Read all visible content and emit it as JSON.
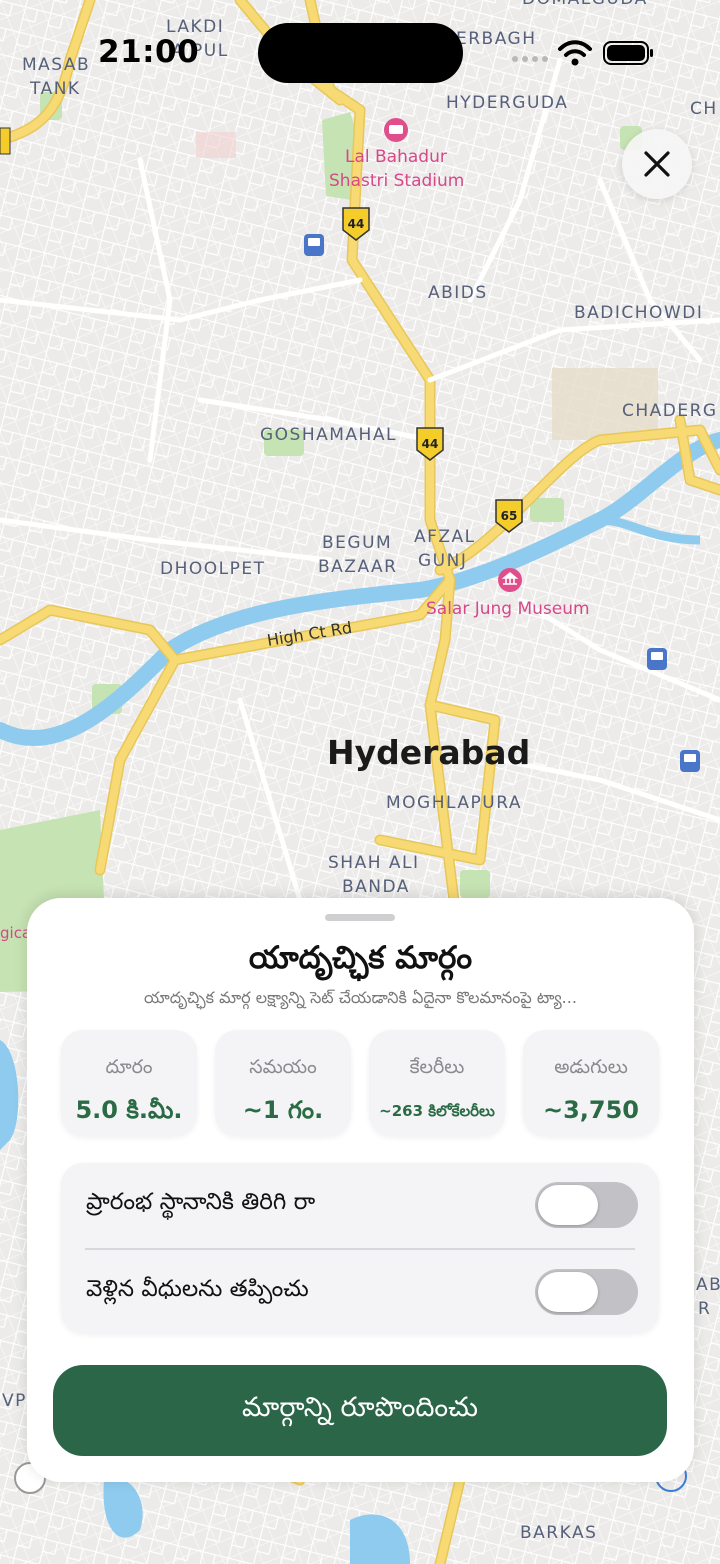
{
  "status_bar": {
    "time": "21:00"
  },
  "map": {
    "city_label": "Hyderabad",
    "labels": {
      "lakdi_ka_pul": [
        "LAKDI",
        "A PUL"
      ],
      "masab_tank": [
        "MASAB",
        "TANK"
      ],
      "himayatnagar": "ERBAGH",
      "domalguda": "DOMALGUDA",
      "hyderguda": "HYDERGUDA",
      "ch": "CH",
      "stadium": [
        "Lal Bahadur",
        "Shastri Stadium"
      ],
      "abids": "ABIDS",
      "badichowdi": "BADICHOWDI",
      "chaderghat": "CHADERG",
      "goshamahal": "GOSHAMAHAL",
      "begum_bazaar": [
        "BEGUM",
        "BAZAAR"
      ],
      "afzal_gunj": [
        "AFZAL",
        "GUNJ"
      ],
      "dhoolpet": "DHOOLPET",
      "salar_jung": "Salar Jung Museum",
      "high_ct_rd": "High Ct Rd",
      "moghlapura": "MOGHLAPURA",
      "shah_ali_banda": [
        "SHAH ALI",
        "BANDA"
      ],
      "gica": "gica",
      "barkas": "BARKAS",
      "ab": [
        "AB",
        "R"
      ],
      "vp": "VP"
    },
    "shields": [
      "44",
      "44",
      "65"
    ]
  },
  "sheet": {
    "title": "యాదృచ్ఛిక మార్గం",
    "subtitle": "యాదృచ్ఛిక మార్గ లక్ష్యాన్ని సెట్ చేయడానికి ఏదైనా కొలమానంపై ట్యా...",
    "stats": [
      {
        "label": "దూరం",
        "value": "5.0 కి.మీ."
      },
      {
        "label": "సమయం",
        "value": "~1 గం."
      },
      {
        "label": "కేలరీలు",
        "value": "~263 కిలోకేలరీలు"
      },
      {
        "label": "అడుగులు",
        "value": "~3,750"
      }
    ],
    "toggles": [
      {
        "label": "ప్రారంభ స్థానానికి తిరిగి రా",
        "on": false
      },
      {
        "label": "వెళ్లిన వీధులను తప్పించు",
        "on": false
      }
    ],
    "cta_label": "మార్గాన్ని రూపొందించు"
  },
  "icons": {
    "close": "close-icon",
    "wifi": "wifi-icon",
    "battery": "battery-icon",
    "stadium": "stadium-icon",
    "museum": "museum-icon",
    "metro": "metro-icon"
  },
  "colors": {
    "accent_green": "#2b6648",
    "road_yellow": "#f5d76e",
    "water_blue": "#8ecbee",
    "park_green": "#c6e3b3"
  }
}
